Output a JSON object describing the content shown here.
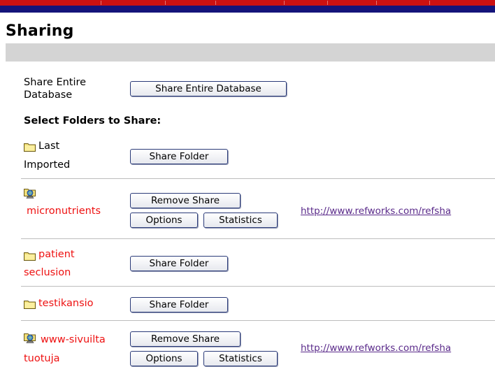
{
  "page": {
    "title": "Sharing"
  },
  "share_database": {
    "label_line1": "Share Entire",
    "label_line2": "Database",
    "button": "Share Entire Database"
  },
  "select_heading": "Select Folders to Share:",
  "folders": [
    {
      "name_line1": "Last",
      "name_line2": "Imported",
      "button": "Share Folder"
    },
    {
      "name_line1": "micronutrients",
      "shared": true,
      "remove_button": "Remove Share",
      "options_button": "Options",
      "statistics_button": "Statistics",
      "url": "http://www.refworks.com/refsha"
    },
    {
      "name_line1": "patient",
      "name_line2": "seclusion",
      "button": "Share Folder"
    },
    {
      "name_line1": "testikansio",
      "button": "Share Folder"
    },
    {
      "name_line1": "www-sivuilta",
      "name_line2": "tuotuja",
      "shared": true,
      "remove_button": "Remove Share",
      "options_button": "Options",
      "statistics_button": "Statistics",
      "url": "http://www.refworks.com/refsha"
    }
  ],
  "icons": {
    "folder": "folder-icon",
    "shared_folder": "shared-folder-icon"
  },
  "colors": {
    "top_red": "#cc1111",
    "top_blue": "#14147a",
    "folder_link": "#ee1111",
    "url": "#5a2a8a"
  }
}
